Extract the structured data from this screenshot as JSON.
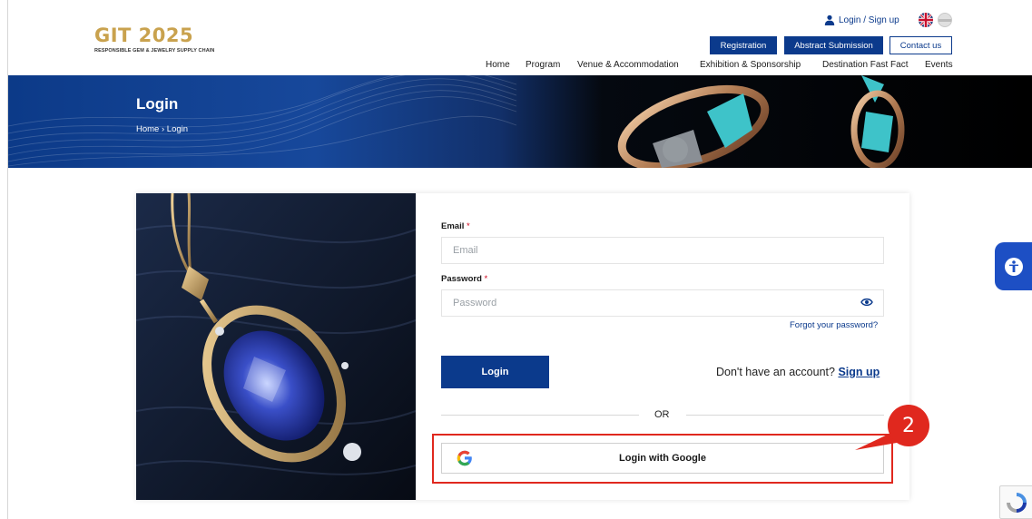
{
  "header": {
    "logo_title": "GIT 2025",
    "logo_subtitle": "RESPONSIBLE GEM & JEWELRY SUPPLY CHAIN",
    "login_signup": "Login / Sign up",
    "buttons": {
      "registration": "Registration",
      "abstract": "Abstract Submission",
      "contact": "Contact us"
    },
    "nav": [
      "Home",
      "Program",
      "Venue & Accommodation",
      "Exhibition & Sponsorship",
      "Destination Fast Fact",
      "Events"
    ]
  },
  "banner": {
    "title": "Login",
    "breadcrumb": "Home  ›  Login"
  },
  "form": {
    "email_label": "Email",
    "email_placeholder": "Email",
    "password_label": "Password",
    "password_placeholder": "Password",
    "required_mark": "*",
    "forgot": "Forgot your password?",
    "login_button": "Login",
    "no_account": "Don't have an account?",
    "signup_link": "Sign up",
    "or": "OR",
    "google_button": "Login with Google"
  },
  "annotation": {
    "step": "2"
  },
  "colors": {
    "brand_blue": "#0b3a8c",
    "gold": "#c9a24e",
    "annotation_red": "#e0281e",
    "a11y_blue": "#1d4fc4"
  },
  "icons": [
    "user-icon",
    "uk-flag-icon",
    "language-flag-icon",
    "eye-icon",
    "google-icon",
    "accessibility-icon",
    "recaptcha-icon"
  ]
}
